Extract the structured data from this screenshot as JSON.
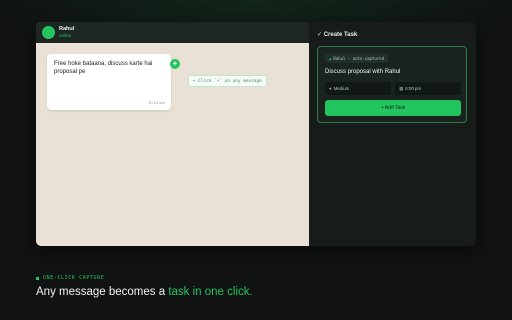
{
  "chat": {
    "contact_name": "Rahul",
    "contact_status": "online",
    "message": "Free hoke bataana, discuss karte hai proposal pe",
    "time": "10:24 am",
    "plus_label": "+",
    "hint": "← Click `+` on any message"
  },
  "panel": {
    "title": "✓ Create Task",
    "tag": "Rahul · auto-captured",
    "task_title": "Discuss proposal with Rahul",
    "priority": "Medium",
    "time": "6:00 pm",
    "add_label": "+ Add Task"
  },
  "caption": {
    "label": "ONE-CLICK CAPTURE",
    "headline_prefix": "Any message becomes a ",
    "headline_accent": "task in one click."
  },
  "colors": {
    "accent": "#22c55e",
    "background": "#101312",
    "chat_background": "#e9e1d5"
  },
  "icons": {
    "avatar": "avatar-circle",
    "tag": "person-icon",
    "priority": "priority-icon",
    "time": "calendar-icon"
  }
}
